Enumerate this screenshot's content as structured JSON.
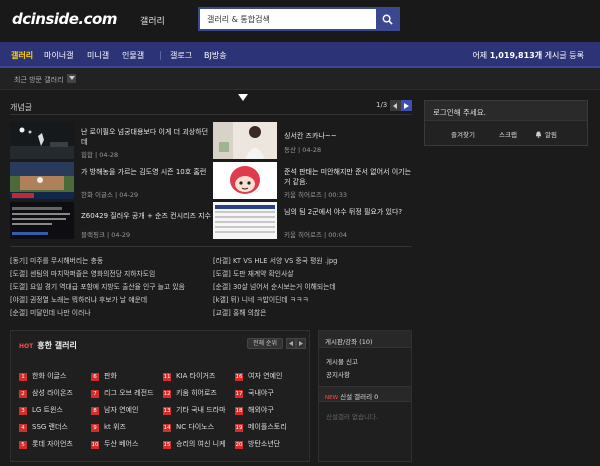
{
  "header": {
    "logo": "dcinside.com",
    "logo_sub": "갤러리",
    "search_placeholder": "갤러리 & 통합검색"
  },
  "nav": {
    "items": [
      "갤러리",
      "마이너갤",
      "미니갤",
      "인물갤",
      "갤로그",
      "BJ방송"
    ],
    "count_prefix": "어제 ",
    "count_value": "1,019,813개",
    "count_suffix": " 게시글 등록"
  },
  "recent": {
    "label": "최근 방문 갤러리"
  },
  "concept": {
    "title": "개념글",
    "page": "1/3",
    "posts": [
      {
        "title": "난 로이필오 넘궁대용보다 이게 더 괴상하던데",
        "meta": "힙합 | 04-28"
      },
      {
        "title": "싱서칸 즈카나~~",
        "meta": "동산 | 04-28"
      },
      {
        "title": "가 방해농을 가르는 김도영 시즌 10호 홈런",
        "meta": "한화 이글스 | 04-29"
      },
      {
        "title": "준석 판태는 미안해지만 준서 없어서 이기는 거 같음.",
        "meta": "키움 히어로즈 | 00:33"
      },
      {
        "title": "Z60429 질러우 공개 + 순즈 컨시리즈 지수",
        "meta": "블랙핑크 | 04-29"
      },
      {
        "title": "님의 팀 2군에서 야수 뒤정 필요가 있다?",
        "meta": "키움 히어로즈 | 00:04"
      }
    ],
    "links": [
      "[동기] 미주를 무시해버리는 충동",
      "[라갤] KT VS HLE 서양 VS 중국 평원 .jpg",
      "[도갤] 센팀의 마치막퍼즐은 영화의전당 지하차도임",
      "[도갤] 도판 재계약 확인사살",
      "[도갤] 요일 경기 역대급 포함에 지방도 출산율 인구 늘고 있음",
      "[순갤] 30살 넘어서 순시보는거 이해되는데",
      "[야갤] 권정열 노래는 뭐하러냐 후보가 날 얘운데",
      "[k갤] 뒤) 니네 ㅋ밥이딘데 ㅋㅋㅋ",
      "[순갤] 미달인데 나만 이러나",
      "[교갤] 홍해 의찮은"
    ]
  },
  "hot": {
    "tag": "HOT",
    "title": "흥한 갤러리",
    "full_label": "전체 순위",
    "items": [
      {
        "rank": "1",
        "name": "한화 이글스"
      },
      {
        "rank": "2",
        "name": "삼성 라이온즈"
      },
      {
        "rank": "3",
        "name": "LG 트윈스"
      },
      {
        "rank": "4",
        "name": "SSG 랜더스"
      },
      {
        "rank": "5",
        "name": "롯데 자이언츠"
      },
      {
        "rank": "6",
        "name": "판화"
      },
      {
        "rank": "7",
        "name": "리그 오브 레전드"
      },
      {
        "rank": "8",
        "name": "남자 연예인"
      },
      {
        "rank": "9",
        "name": "kt 위즈"
      },
      {
        "rank": "10",
        "name": "두산 베어스"
      },
      {
        "rank": "11",
        "name": "KIA 타이거즈"
      },
      {
        "rank": "12",
        "name": "키움 히어로즈"
      },
      {
        "rank": "13",
        "name": "기타 국내 드라마"
      },
      {
        "rank": "14",
        "name": "NC 다이노스"
      },
      {
        "rank": "15",
        "name": "승리의 여신 니케"
      },
      {
        "rank": "16",
        "name": "여자 연예인"
      },
      {
        "rank": "17",
        "name": "국내야구"
      },
      {
        "rank": "18",
        "name": "해외야구"
      },
      {
        "rank": "19",
        "name": "메이플스토리"
      },
      {
        "rank": "20",
        "name": "방탄소년단"
      }
    ]
  },
  "login": {
    "title": "로그인해 주세요.",
    "links": [
      "즐겨찾기",
      "스크랩",
      "알림"
    ]
  },
  "notice": {
    "head": "게시판/강좌 (10)",
    "items": [
      "게시물 신고",
      "공지사항"
    ],
    "new_tag": "NEW",
    "new_title": "신설 갤러리 0",
    "new_empty": "신설갤러 없습니다."
  }
}
